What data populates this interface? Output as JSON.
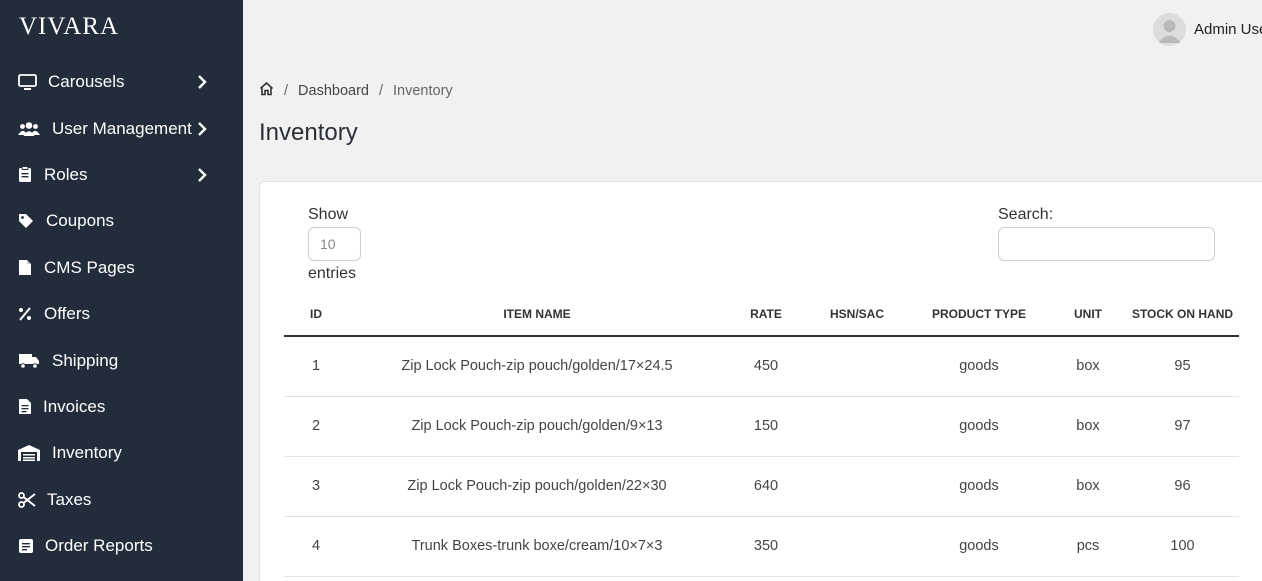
{
  "brand": "VIVARA",
  "sidebar": {
    "items": [
      {
        "label": "Carousels",
        "icon": "monitor-icon",
        "has_chevron": true
      },
      {
        "label": "User Management",
        "icon": "users-icon",
        "has_chevron": true
      },
      {
        "label": "Roles",
        "icon": "clipboard-icon",
        "has_chevron": true
      },
      {
        "label": "Coupons",
        "icon": "tag-icon",
        "has_chevron": false
      },
      {
        "label": "CMS Pages",
        "icon": "file-icon",
        "has_chevron": false
      },
      {
        "label": "Offers",
        "icon": "percent-icon",
        "has_chevron": false
      },
      {
        "label": "Shipping",
        "icon": "truck-icon",
        "has_chevron": false
      },
      {
        "label": "Invoices",
        "icon": "invoice-icon",
        "has_chevron": false
      },
      {
        "label": "Inventory",
        "icon": "warehouse-icon",
        "has_chevron": false
      },
      {
        "label": "Taxes",
        "icon": "scissors-icon",
        "has_chevron": false
      },
      {
        "label": "Order Reports",
        "icon": "report-icon",
        "has_chevron": false
      }
    ]
  },
  "header": {
    "user_name": "Admin User"
  },
  "breadcrumb": {
    "items": [
      "Dashboard",
      "Inventory"
    ]
  },
  "page_title": "Inventory",
  "table_controls": {
    "show_label": "Show",
    "page_size": "10",
    "entries_label": "entries",
    "search_label": "Search:",
    "search_value": ""
  },
  "table": {
    "columns": [
      "ID",
      "ITEM NAME",
      "RATE",
      "HSN/SAC",
      "PRODUCT TYPE",
      "UNIT",
      "STOCK ON HAND"
    ],
    "rows": [
      [
        "1",
        "Zip Lock Pouch-zip pouch/golden/17×24.5",
        "450",
        "",
        "goods",
        "box",
        "95"
      ],
      [
        "2",
        "Zip Lock Pouch-zip pouch/golden/9×13",
        "150",
        "",
        "goods",
        "box",
        "97"
      ],
      [
        "3",
        "Zip Lock Pouch-zip pouch/golden/22×30",
        "640",
        "",
        "goods",
        "box",
        "96"
      ],
      [
        "4",
        "Trunk Boxes-trunk boxe/cream/10×7×3",
        "350",
        "",
        "goods",
        "pcs",
        "100"
      ]
    ]
  },
  "colors": {
    "sidebar_bg": "#222c3b",
    "page_bg": "#f1f1f1",
    "card_bg": "#ffffff"
  }
}
